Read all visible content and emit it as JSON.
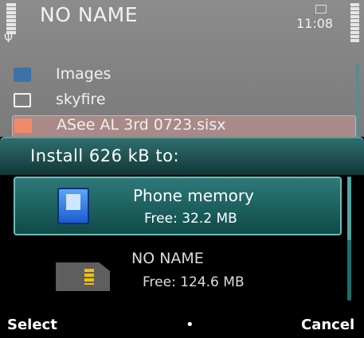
{
  "status_bar": {
    "title": "NO NAME",
    "time": "11:08"
  },
  "file_list": {
    "items": [
      {
        "label": "Images",
        "icon": "images-folder-icon"
      },
      {
        "label": "skyfire",
        "icon": "folder-icon"
      },
      {
        "label": "ASee AL 3rd 0723.sisx",
        "icon": "sisx-file-icon",
        "selected": true
      }
    ]
  },
  "dialog": {
    "title": "Install 626 kB to:",
    "options": [
      {
        "name": "Phone memory",
        "free": "Free: 32.2 MB",
        "icon": "phone-memory-icon",
        "highlighted": true
      },
      {
        "name": "NO NAME",
        "free": "Free: 124.6 MB",
        "icon": "memory-card-icon",
        "highlighted": false
      }
    ]
  },
  "softkeys": {
    "left": "Select",
    "middle": "•",
    "right": "Cancel"
  },
  "colors": {
    "accent": "#2d7a78",
    "highlight_border": "#6fbcb8",
    "background": "#000000"
  }
}
